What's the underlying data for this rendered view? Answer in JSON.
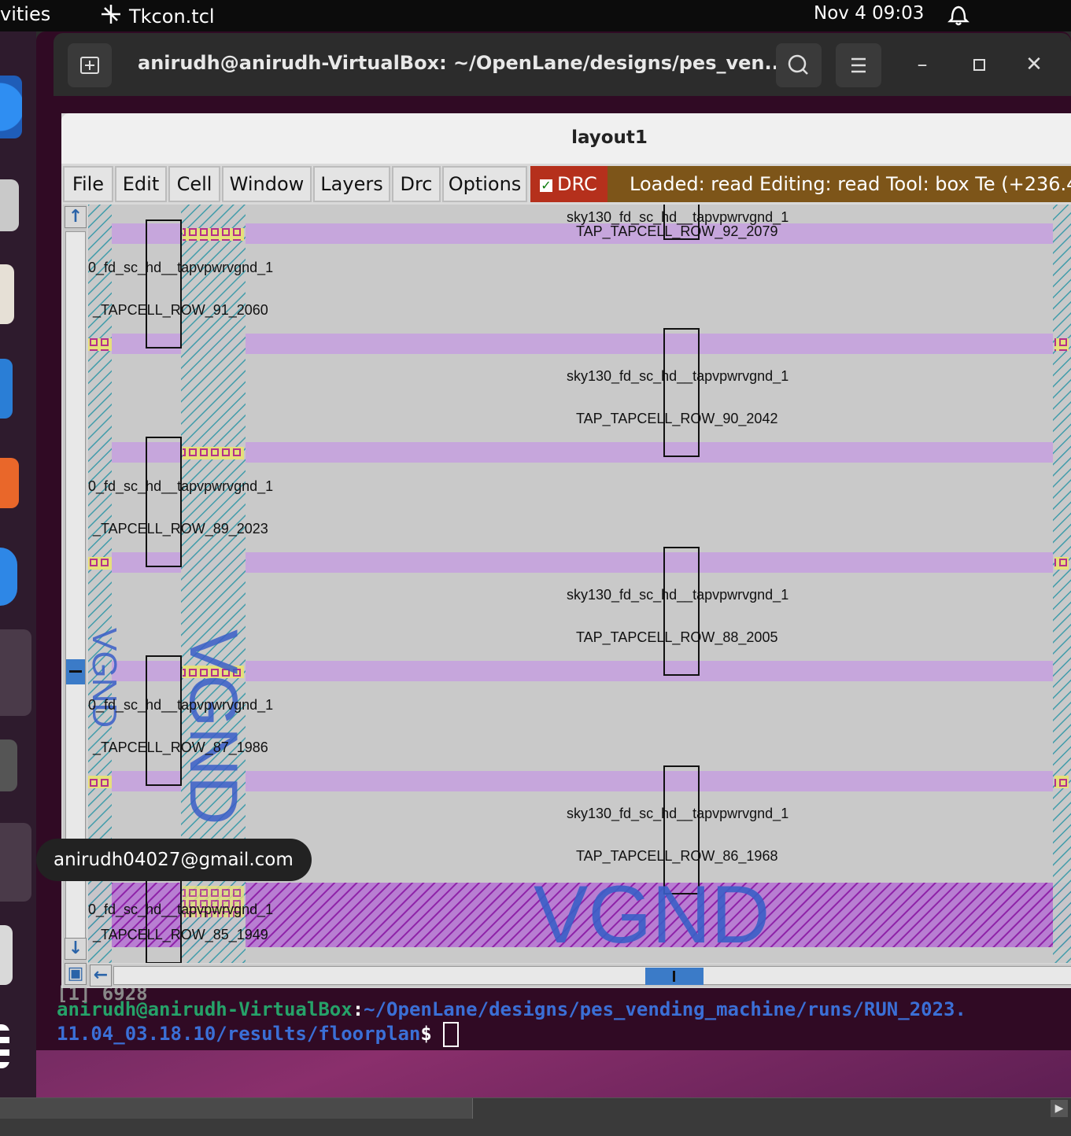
{
  "topbar": {
    "activities": "vities",
    "app_name": "Tkcon.tcl",
    "clock": "Nov 4  09:03"
  },
  "terminal": {
    "title": "anirudh@anirudh-VirtualBox: ~/OpenLane/designs/pes_ven...",
    "partial_line": "[1] 6928",
    "prompt_user": "anirudh@anirudh-VirtualBox",
    "prompt_colon": ":",
    "prompt_path_1": "~/OpenLane/designs/pes_vending_machine/runs/RUN_2023.",
    "prompt_path_2": "11.04_03.18.10/results/floorplan",
    "prompt_symbol": "$"
  },
  "layout_window": {
    "title": "layout1",
    "menu": [
      "File",
      "Edit",
      "Cell",
      "Window",
      "Layers",
      "Drc",
      "Options"
    ],
    "drc_label": "DRC",
    "status": "Loaded: read  Editing: read  Tool: box  Te   (+236.4"
  },
  "cells": {
    "left_name": "0_fd_sc_hd__tapvpwrvgnd_1",
    "center_name": "sky130_fd_sc_hd__tapvpwrvgnd_1",
    "rows": [
      {
        "left": "_TAPCELL_ROW_91_2060"
      },
      {
        "left": "_TAPCELL_ROW_89_2023"
      },
      {
        "left": "_TAPCELL_ROW_87_1986"
      },
      {
        "left": "_TAPCELL_ROW_85_1949"
      }
    ],
    "center_rows": [
      "TAP_TAPCELL_ROW_92_2079",
      "TAP_TAPCELL_ROW_90_2042",
      "TAP_TAPCELL_ROW_88_2005",
      "TAP_TAPCELL_ROW_86_1968"
    ],
    "vgnd_label": "VGND"
  },
  "tooltip": "anirudh04027@gmail.com",
  "colors": {
    "terminal_bg": "#300a24",
    "drc_button": "#b5301c",
    "status_bar": "#7d5519",
    "metal_row": "#c9a9dd",
    "scroll_accent": "#3b7bc8"
  }
}
